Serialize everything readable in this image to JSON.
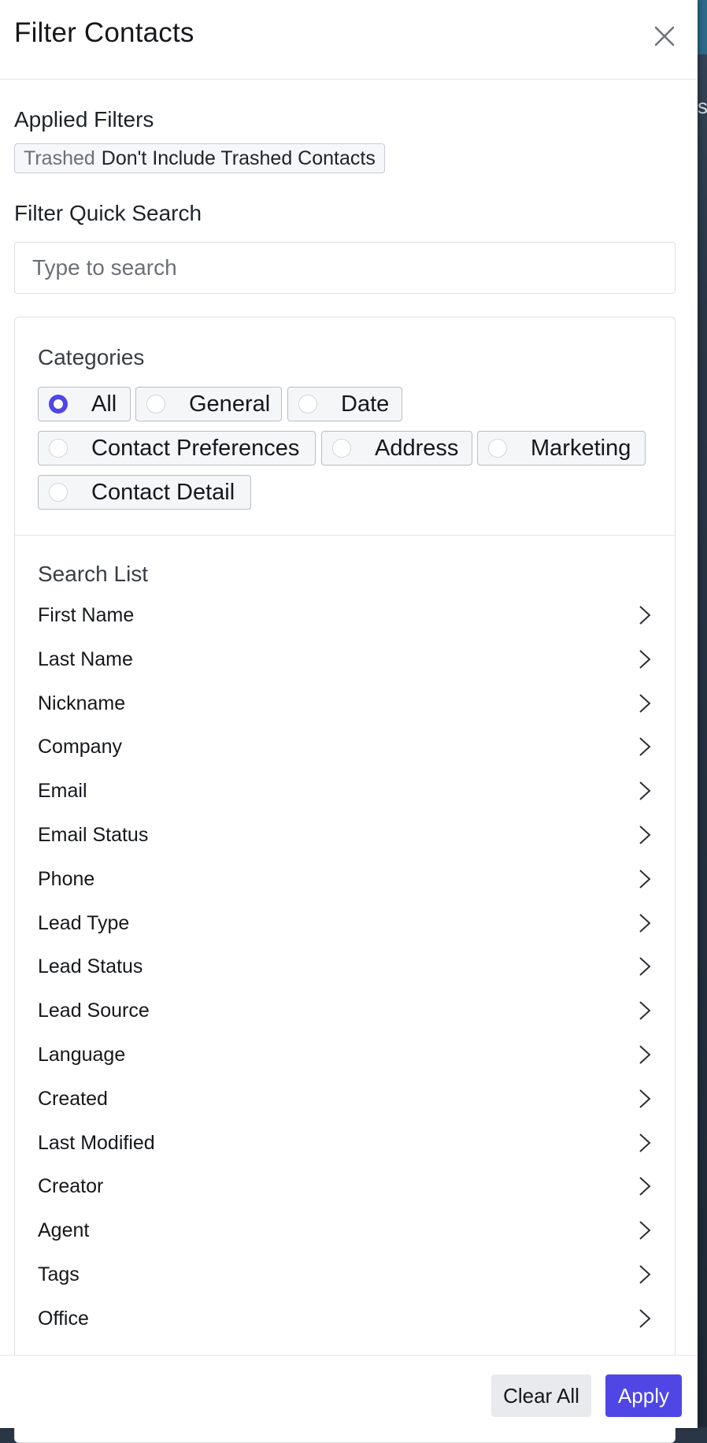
{
  "panel": {
    "title": "Filter Contacts",
    "close_icon": "close-icon"
  },
  "applied_filters": {
    "label": "Applied Filters",
    "chips": [
      {
        "key": "Trashed",
        "value": "Don't Include Trashed Contacts"
      }
    ]
  },
  "quick_search": {
    "label": "Filter Quick Search",
    "value": "",
    "placeholder": "Type to search"
  },
  "categories": {
    "label": "Categories",
    "selected": "All",
    "options": [
      "All",
      "General",
      "Date",
      "Contact Preferences",
      "Address",
      "Marketing",
      "Contact Detail"
    ]
  },
  "search_list": {
    "label": "Search List",
    "chevron_icon": "chevron-right-icon",
    "items": [
      "First Name",
      "Last Name",
      "Nickname",
      "Company",
      "Email",
      "Email Status",
      "Phone",
      "Lead Type",
      "Lead Status",
      "Lead Source",
      "Language",
      "Created",
      "Last Modified",
      "Creator",
      "Agent",
      "Tags",
      "Office"
    ]
  },
  "footer": {
    "clear_label": "Clear All",
    "apply_label": "Apply"
  },
  "colors": {
    "accent": "#4f46e5",
    "backdrop": "#2a3646"
  }
}
